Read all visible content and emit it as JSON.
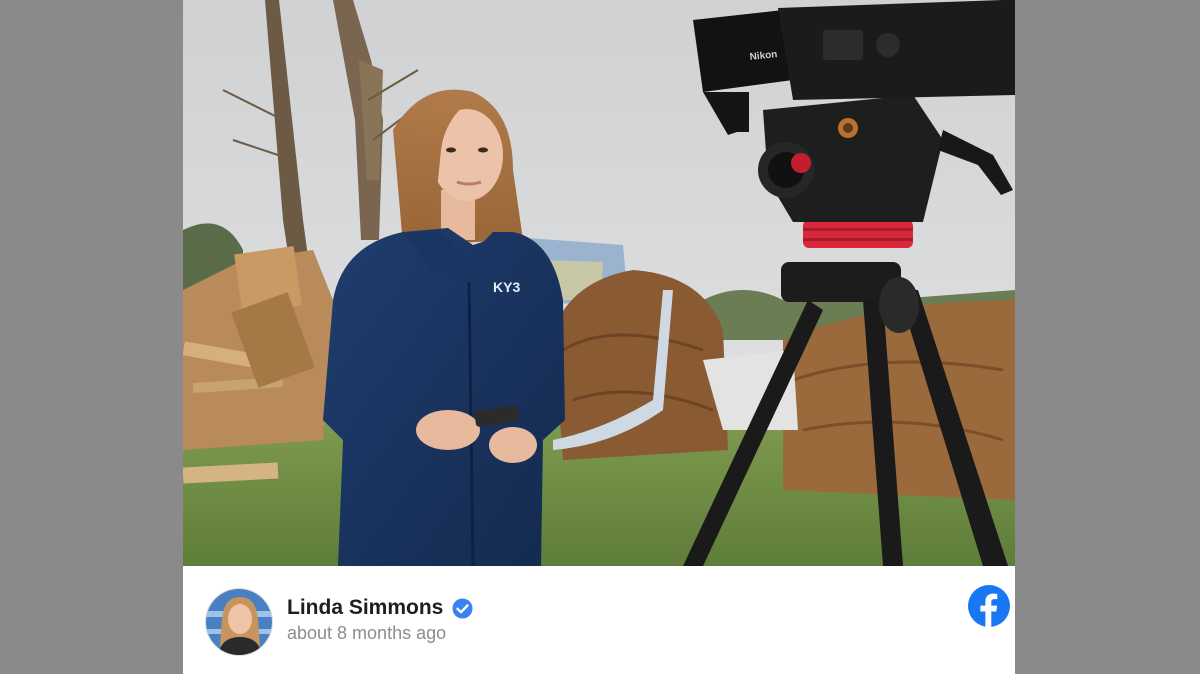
{
  "post": {
    "author_name": "Linda Simmons",
    "timestamp": "about 8 months ago",
    "verified": true,
    "photo_jacket_text": "KY3"
  },
  "icons": {
    "verified": "verified-badge-icon",
    "platform": "facebook-icon",
    "camera_brand_text": "Nikon"
  },
  "colors": {
    "backdrop": "#8a8a8a",
    "facebook_blue": "#1877f2",
    "verified_blue": "#3b82f0",
    "name": "#1c1e21",
    "meta": "#8a8d91"
  }
}
